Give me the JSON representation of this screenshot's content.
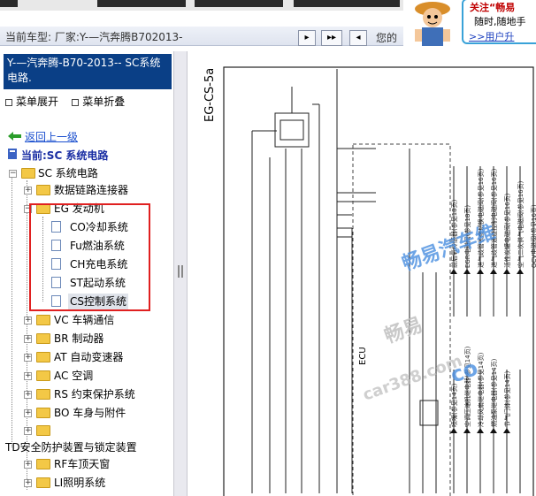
{
  "toolbar": {
    "car_label": "当前车型:   厂家:Y-—汽奔腾B702013-",
    "btn1": "▸",
    "btn2": "▸▸",
    "btn3": "◂",
    "partial_text": "您的"
  },
  "ad": {
    "line1": "关注“畅易",
    "line2": "随时,随地手",
    "line3": ">>用户升"
  },
  "left": {
    "header": "Y-—汽奔腾-B70-2013-- SC系统电路.",
    "expand": "菜单展开",
    "collapse": "菜单折叠",
    "back": "返回上一级",
    "current": "当前:SC 系统电路"
  },
  "tree": [
    {
      "label": "SC 系统电路"
    },
    {
      "label": "数据链路连接器"
    },
    {
      "label": "EG 发动机"
    },
    {
      "label": "CO冷却系统"
    },
    {
      "label": "Fu燃油系统"
    },
    {
      "label": "CH充电系统"
    },
    {
      "label": "ST起动系统"
    },
    {
      "label": "CS控制系统"
    },
    {
      "label": "VC 车辆通信"
    },
    {
      "label": "BR 制动器"
    },
    {
      "label": "AT 自动变速器"
    },
    {
      "label": "AC 空调"
    },
    {
      "label": "RS 约束保护系统"
    },
    {
      "label": "BO 车身与附件"
    },
    {
      "label": "TD安全防护装置与锁定装置"
    },
    {
      "label": "RF车顶天窗"
    },
    {
      "label": "LI照明系统"
    }
  ],
  "diagram": {
    "page_code": "EG-CS-5a",
    "ecu": "ECU",
    "legend": [
      "前后氧传感器(参见18页)",
      "EGR电磁阀(参见18页)",
      "进气歧管长度切换电磁阀(参见16页)",
      "进气歧管通道控制电磁阀(参见16页)",
      "活性炭罐电磁阀(参见16页)",
      "空气二次供气电磁阀(参见16页)",
      "OCV电磁阀(参见16页)"
    ],
    "legend2": [
      "喷嘴(参见14页)",
      "空调压缩机继电器(参见14页)",
      "冷却风扇继电器(参见14页)",
      "燃油泵继电器(参见14页)",
      "节气门体(参见14页)"
    ],
    "watermark1": "畅易汽车维",
    "watermark2": "畅易",
    "watermark3": "car388.com",
    "watermark4": "co"
  }
}
